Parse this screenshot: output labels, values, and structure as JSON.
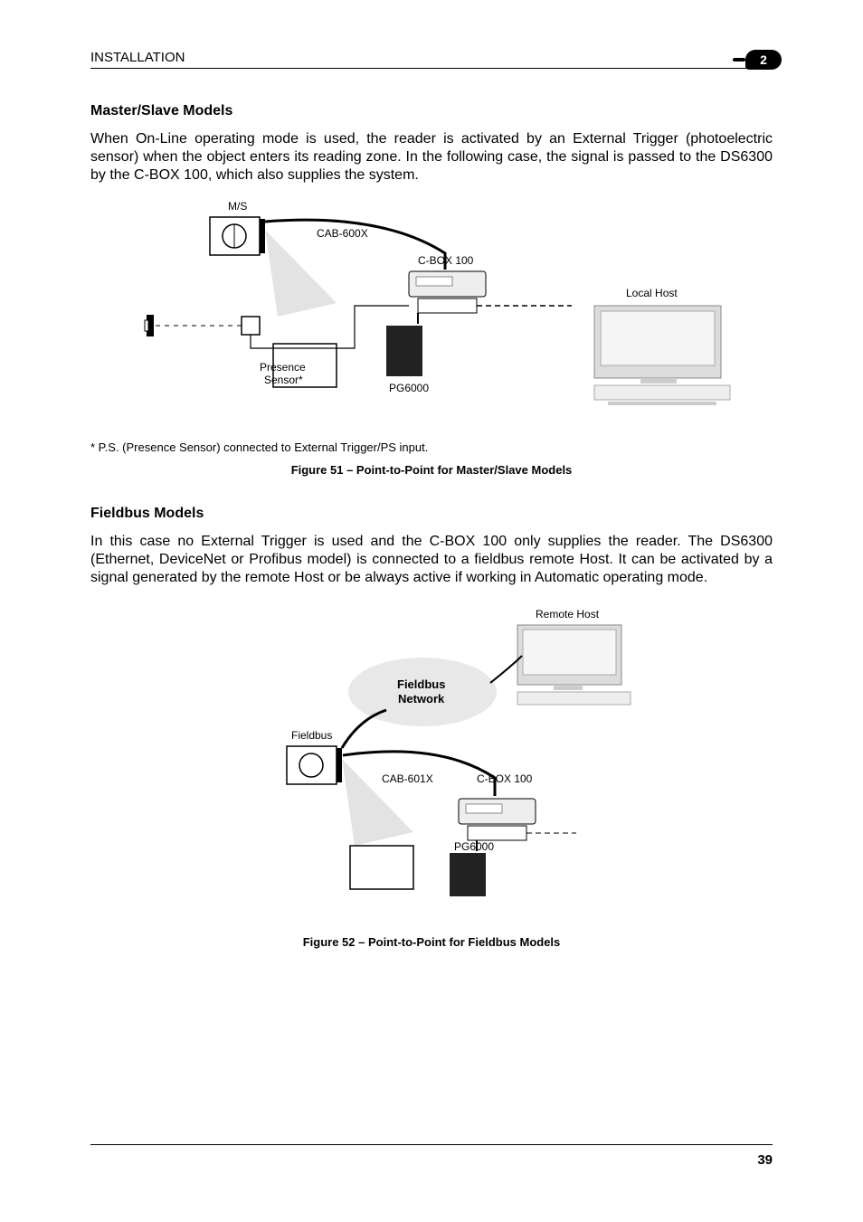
{
  "header": {
    "section": "INSTALLATION",
    "chapter": "2"
  },
  "s1": {
    "heading": "Master/Slave Models",
    "para": "When On-Line operating mode is used, the reader is activated by an External Trigger (photoelectric sensor) when the object enters its reading zone. In the following case, the signal is passed to the DS6300 by the C-BOX 100, which also supplies the system."
  },
  "fig1": {
    "labels": {
      "ms": "M/S",
      "cab": "CAB-600X",
      "cbox": "C-BOX 100",
      "localhost": "Local Host",
      "presence1": "Presence",
      "presence2": "Sensor*",
      "pg": "PG6000"
    },
    "footnote": "*    P.S. (Presence Sensor) connected to External Trigger/PS input.",
    "caption": "Figure 51 – Point-to-Point for Master/Slave Models"
  },
  "s2": {
    "heading": "Fieldbus Models",
    "para": "In this case no External Trigger is used and the C-BOX 100 only supplies the reader. The DS6300 (Ethernet, DeviceNet or Profibus model) is connected to a fieldbus remote Host. It can be activated by a signal generated by the remote Host or be always active if working in Automatic operating mode."
  },
  "fig2": {
    "labels": {
      "remotehost": "Remote Host",
      "fieldbusnet1": "Fieldbus",
      "fieldbusnet2": "Network",
      "fieldbus": "Fieldbus",
      "cab": "CAB-601X",
      "cbox": "C-BOX 100",
      "pg": "PG6000"
    },
    "caption": "Figure 52 – Point-to-Point for Fieldbus Models"
  },
  "footer": {
    "page": "39"
  }
}
